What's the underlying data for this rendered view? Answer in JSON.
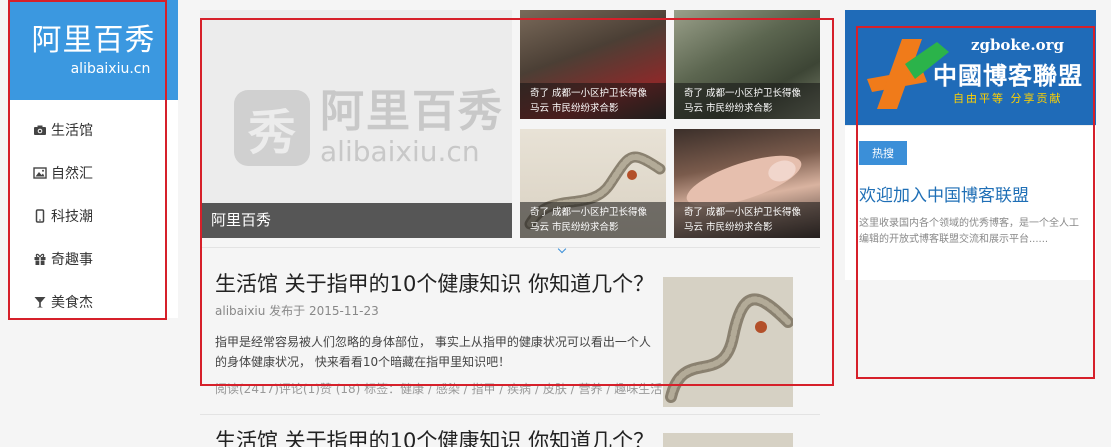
{
  "sidebar": {
    "brand_name": "阿里百秀",
    "brand_domain": "alibaixiu.cn",
    "items": [
      {
        "label": "生活馆",
        "icon": "camera-icon"
      },
      {
        "label": "自然汇",
        "icon": "image-icon"
      },
      {
        "label": "科技潮",
        "icon": "phone-icon"
      },
      {
        "label": "奇趣事",
        "icon": "gift-icon"
      },
      {
        "label": "美食杰",
        "icon": "glass-icon"
      }
    ]
  },
  "hero": {
    "logo_mark": "秀",
    "logo_cn": "阿里百秀",
    "logo_en": "alibaixiu.cn",
    "caption": "阿里百秀"
  },
  "thumbs": [
    {
      "line1": "奇了 成都一小区护卫长得像",
      "line2": "马云 市民纷纷求合影"
    },
    {
      "line1": "奇了 成都一小区护卫长得像",
      "line2": "马云 市民纷纷求合影"
    },
    {
      "line1": "奇了 成都一小区护卫长得像",
      "line2": "马云 市民纷纷求合影"
    },
    {
      "line1": "奇了 成都一小区护卫长得像",
      "line2": "马云 市民纷纷求合影"
    }
  ],
  "articles": [
    {
      "title": "生活馆 关于指甲的10个健康知识 你知道几个？",
      "meta": "alibaixiu 发布于 2015-11-23",
      "excerpt": "指甲是经常容易被人们忽略的身体部位， 事实上从指甲的健康状况可以看出一个人的身体健康状况， 快来看看10个暗藏在指甲里知识吧！",
      "tags": "阅读(2417)评论(1)赞 (18) 标签：健康 / 感染 / 指甲 / 疾病 / 皮肤 / 营养 / 趣味生活"
    },
    {
      "title": "生活馆 关于指甲的10个健康知识 你知道几个？"
    }
  ],
  "right_panel": {
    "banner_domain": "zgboke.org",
    "banner_name": "中國博客聯盟",
    "banner_slogan": "自由平等  分享贡献",
    "badge": "热搜",
    "title": "欢迎加入中国博客联盟",
    "description": "这里收录国内各个领域的优秀博客，是一个全人工编辑的开放式博客联盟交流和展示平台......"
  },
  "colors": {
    "brand": "#3b98e0",
    "highlight_box": "#d6202a",
    "link": "#1f6fb6"
  }
}
